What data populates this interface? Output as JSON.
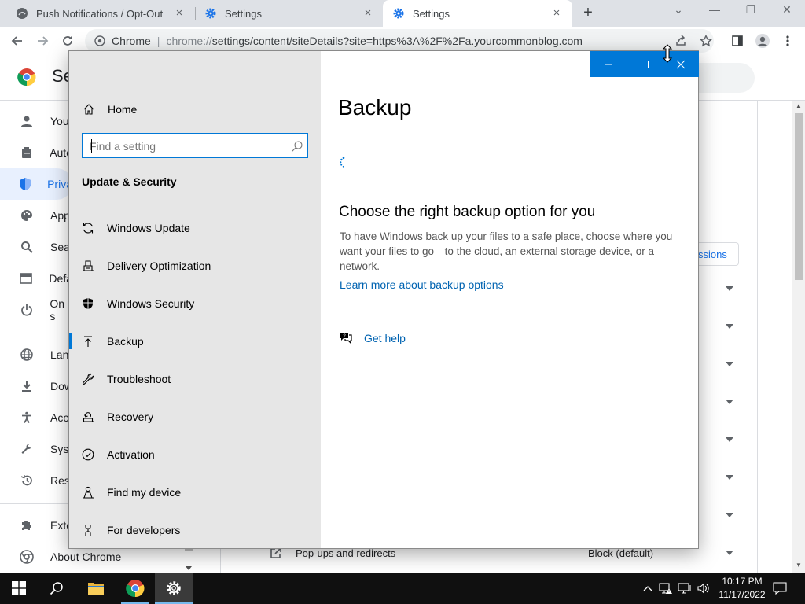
{
  "browser": {
    "tabs": [
      {
        "title": "Push Notifications / Opt-Out",
        "close": "×"
      },
      {
        "title": "Settings",
        "close": "×"
      },
      {
        "title": "Settings",
        "close": "×"
      }
    ],
    "new_tab": "+",
    "strip_controls": {
      "tab_search": "⌄",
      "minimize": "—",
      "restore": "❐",
      "close": "✕"
    },
    "omnibox": {
      "chip": "Chrome",
      "separator": "|",
      "url_prefix": "chrome://",
      "url_main": "settings/content/siteDetails?site=https%3A%2F%2Fa.yourcommonblog.com"
    }
  },
  "chrome_settings": {
    "title": "Se",
    "nav": [
      {
        "label": "You",
        "icon": "person-icon"
      },
      {
        "label": "Auto",
        "icon": "clipboard-icon"
      },
      {
        "label": "Priva",
        "icon": "shield-icon"
      },
      {
        "label": "App",
        "icon": "palette-icon"
      },
      {
        "label": "Sea",
        "icon": "search-icon"
      },
      {
        "label": "Defa",
        "icon": "browser-icon"
      },
      {
        "label": "On s",
        "icon": "power-icon"
      },
      {
        "label": "Lan",
        "icon": "globe-icon"
      },
      {
        "label": "Dow",
        "icon": "download-icon"
      },
      {
        "label": "Acc",
        "icon": "accessibility-icon"
      },
      {
        "label": "Syst",
        "icon": "wrench-icon"
      },
      {
        "label": "Res",
        "icon": "history-icon"
      },
      {
        "label": "Exte",
        "icon": "puzzle-icon"
      }
    ],
    "about": "About Chrome",
    "permissions_button": "ssions",
    "popups_label": "Pop-ups and redirects",
    "popups_value": "Block (default)"
  },
  "settings_window": {
    "controls": {
      "minimize": "—",
      "maximize": "☐",
      "close": "✕"
    },
    "home": "Home",
    "search_placeholder": "Find a setting",
    "section": "Update & Security",
    "nav": [
      {
        "label": "Windows Update",
        "icon": "sync-icon"
      },
      {
        "label": "Delivery Optimization",
        "icon": "delivery-icon"
      },
      {
        "label": "Windows Security",
        "icon": "shield-icon"
      },
      {
        "label": "Backup",
        "icon": "backup-arrow-icon"
      },
      {
        "label": "Troubleshoot",
        "icon": "wrench-icon"
      },
      {
        "label": "Recovery",
        "icon": "recovery-icon"
      },
      {
        "label": "Activation",
        "icon": "checkmark-circle-icon"
      },
      {
        "label": "Find my device",
        "icon": "person-location-icon"
      },
      {
        "label": "For developers",
        "icon": "developer-icon"
      }
    ],
    "selected": "Backup",
    "page_title": "Backup",
    "heading": "Choose the right backup option for you",
    "body": "To have Windows back up your files to a safe place, choose where you want your files to go—to the cloud, an external storage device, or a network.",
    "learn_more": "Learn more about backup options",
    "get_help": "Get help"
  },
  "taskbar": {
    "time": "10:17 PM",
    "date": "11/17/2022"
  },
  "colors": {
    "accent_windows": "#0078d7",
    "chrome_blue": "#1a73e8",
    "taskbar": "#101010"
  }
}
